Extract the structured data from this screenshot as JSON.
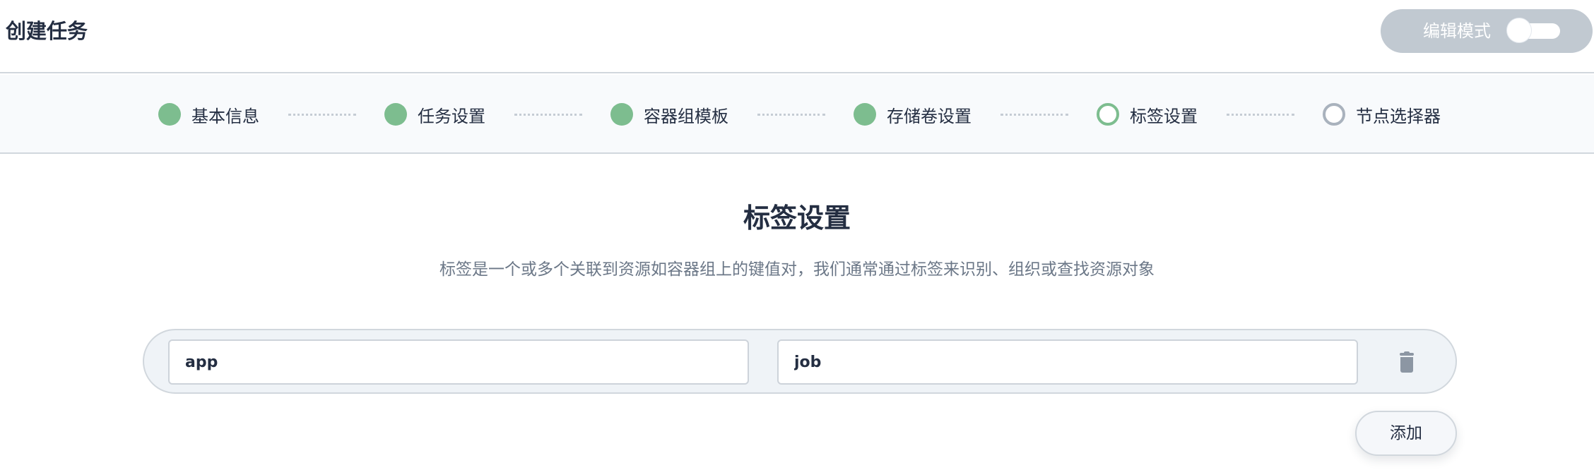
{
  "header": {
    "title": "创建任务",
    "edit_mode_label": "编辑模式",
    "edit_mode_on": false
  },
  "steps": [
    {
      "label": "基本信息",
      "status": "done"
    },
    {
      "label": "任务设置",
      "status": "done"
    },
    {
      "label": "容器组模板",
      "status": "done"
    },
    {
      "label": "存储卷设置",
      "status": "done"
    },
    {
      "label": "标签设置",
      "status": "current"
    },
    {
      "label": "节点选择器",
      "status": "pending"
    }
  ],
  "content": {
    "title": "标签设置",
    "description": "标签是一个或多个关联到资源如容器组上的键值对，我们通常通过标签来识别、组织或查找资源对象"
  },
  "labels": [
    {
      "key": "app",
      "value": "job"
    }
  ],
  "icons": {
    "delete": "trash-icon"
  },
  "actions": {
    "add_label": "添加"
  },
  "colors": {
    "step_done": "#7dbd8f",
    "step_pending": "#a9b2bd",
    "edit_mode_bg": "#c1c9d1"
  }
}
